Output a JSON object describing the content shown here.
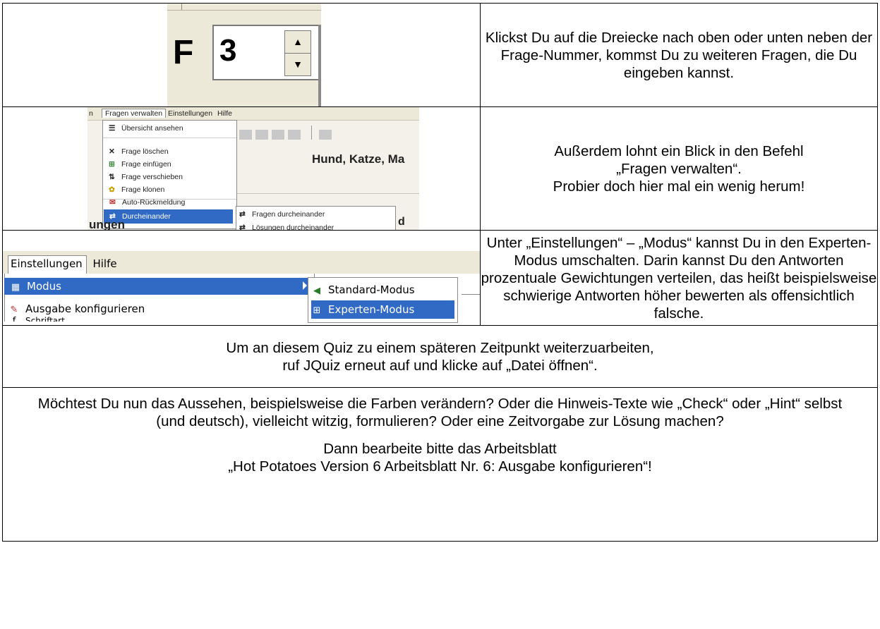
{
  "row1": {
    "spinner": {
      "label": "F",
      "value": "3",
      "up_icon": "triangle-up-icon",
      "down_icon": "triangle-down-icon"
    },
    "text": "Klickst Du auf die Dreiecke nach oben oder unten neben der Frage-Nummer, kommst Du zu weiteren Fragen, die Du eingeben kannst."
  },
  "row2": {
    "menubar": [
      "n",
      "Fragen verwalten",
      "Einstellungen",
      "Hilfe"
    ],
    "items": [
      {
        "label": "Übersicht ansehen",
        "icon": "list-icon"
      },
      {
        "label": "Frage löschen",
        "icon": "delete-icon"
      },
      {
        "label": "Frage einfügen",
        "icon": "insert-icon"
      },
      {
        "label": "Frage verschieben",
        "icon": "move-icon"
      },
      {
        "label": "Frage klonen",
        "icon": "clone-icon"
      },
      {
        "label": "Auto-Rückmeldung",
        "icon": "feedback-icon"
      },
      {
        "label": "Durcheinander",
        "icon": "shuffle-icon"
      }
    ],
    "submenu": [
      {
        "label": "Fragen durcheinander",
        "icon": "shuffle-icon"
      },
      {
        "label": "Lösungen durcheinander",
        "icon": "shuffle-icon"
      }
    ],
    "title_fragment": "Hund, Katze, Ma",
    "tab_fragment": "ungen",
    "tab_fragment_right": "d",
    "text_lines": [
      "Außerdem lohnt ein Blick in den Befehl",
      "„Fragen verwalten“.",
      "Probier doch hier mal ein wenig herum!"
    ]
  },
  "row3": {
    "menubar": [
      "Einstellungen",
      "Hilfe"
    ],
    "items": [
      {
        "label": "Modus",
        "icon": "mode-icon"
      },
      {
        "label": "Ausgabe konfigurieren",
        "icon": "output-icon"
      },
      {
        "label": "Schriftart",
        "icon": "font-icon"
      }
    ],
    "submenu": [
      {
        "label": "Standard-Modus",
        "icon": "standard-mode-icon"
      },
      {
        "label": "Experten-Modus",
        "icon": "expert-mode-icon"
      }
    ],
    "text": "Unter „Einstellungen“ – „Modus“ kannst Du in den Experten-Modus umschalten. Darin kannst Du den Antworten prozentuale Gewichtungen verteilen, das heißt beispielsweise schwierige Antworten höher bewerten als offensichtlich falsche."
  },
  "row4": {
    "line1": "Um an diesem Quiz zu einem späteren Zeitpunkt weiterzuarbeiten,",
    "line2": "ruf JQuiz erneut auf und klicke auf „Datei öffnen“."
  },
  "row5": {
    "para1": "Möchtest Du nun das Aussehen, beispielsweise die Farben verändern? Oder die Hinweis-Texte wie „Check“ oder „Hint“ selbst (und deutsch), vielleicht witzig, formulieren? Oder eine Zeitvorgabe zur Lösung machen?",
    "para2_line1": "Dann bearbeite bitte das Arbeitsblatt",
    "para2_line2": "„Hot Potatoes Version 6 Arbeitsblatt Nr. 6: Ausgabe konfigurieren“!"
  }
}
